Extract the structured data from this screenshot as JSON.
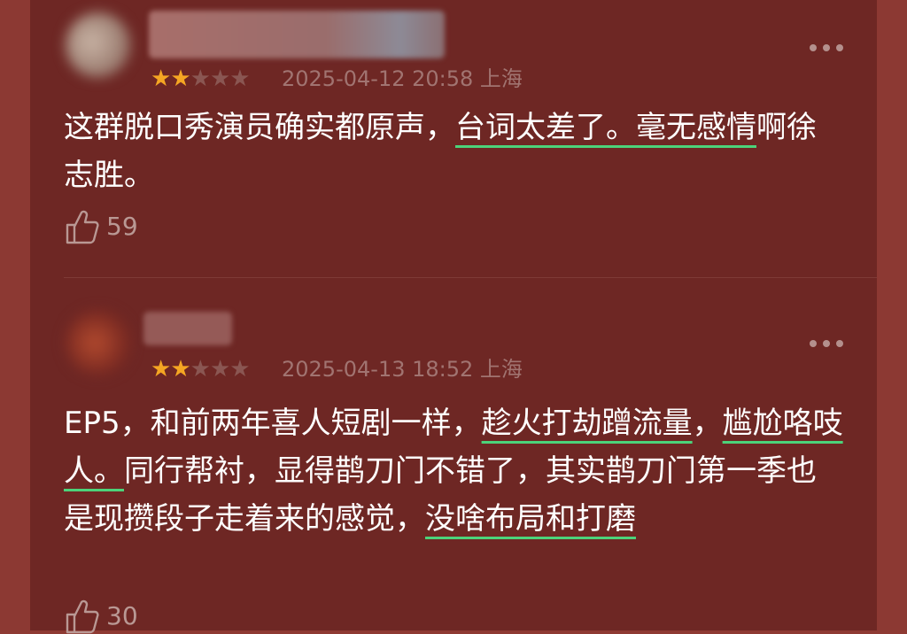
{
  "comments": [
    {
      "rating": 2,
      "date": "2025-04-12 20:58 上海",
      "segments": [
        {
          "t": "这群脱口秀演员确实都原声，",
          "hl": false
        },
        {
          "t": "台词太差了。毫无感情",
          "hl": true
        },
        {
          "t": "啊徐志胜。",
          "hl": false
        }
      ],
      "likes": "59"
    },
    {
      "rating": 2,
      "date": "2025-04-13 18:52 上海",
      "segments": [
        {
          "t": "EP5，和前两年喜人短剧一样，",
          "hl": false
        },
        {
          "t": "趁火打劫蹭流量",
          "hl": true
        },
        {
          "t": "，",
          "hl": false
        },
        {
          "t": "尴尬咯吱人。",
          "hl": true
        },
        {
          "t": "同行帮衬，显得鹊刀门不错了，其实鹊刀门第一季也是现攒段子走着来的感觉，",
          "hl": false
        },
        {
          "t": "没啥布局和打磨",
          "hl": true
        }
      ],
      "likes": "30"
    }
  ],
  "colors": {
    "page_bg": "#8e3a33",
    "card_bg": "#6e2724",
    "star_on": "#f5a623",
    "underline": "#4cd37a"
  },
  "icons": {
    "more": "more-dots-icon",
    "like": "thumbs-up-icon",
    "star": "star-icon"
  }
}
